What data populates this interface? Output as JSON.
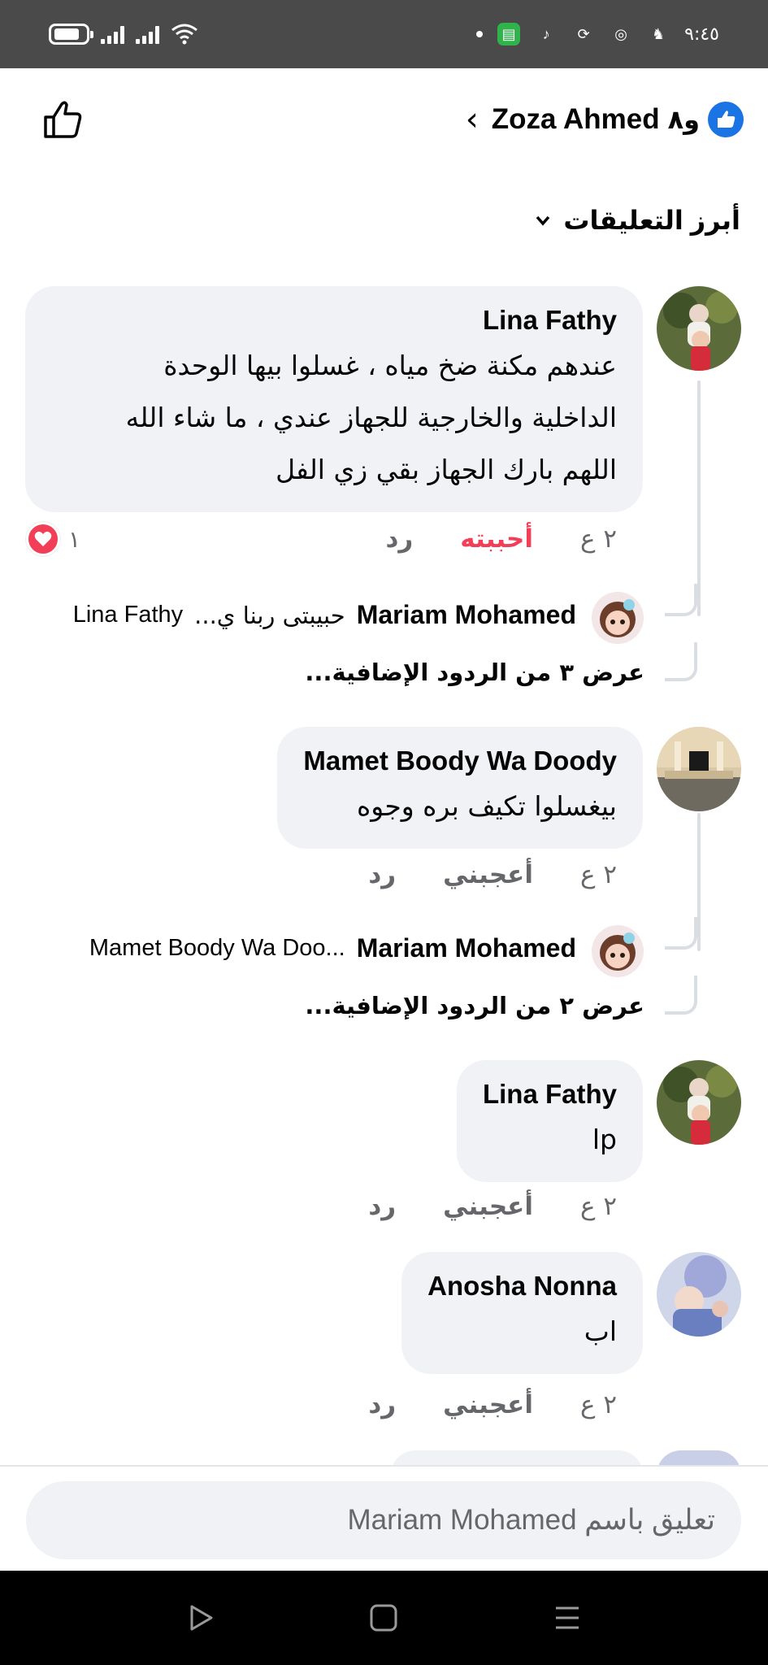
{
  "status_bar": {
    "time": "٩:٤٥",
    "icons": [
      "battery-icon",
      "signal-icon",
      "signal-icon",
      "wifi-icon",
      "dot-icon",
      "messages-app-icon",
      "tiktok-icon",
      "sync-icon",
      "messenger-icon",
      "snapchat-icon"
    ]
  },
  "header": {
    "author": "Zoza Ahmed",
    "others": "و٨",
    "back_icon": "chevron-left-icon",
    "like_icon": "thumbs-up-outline-icon",
    "reaction_badge": "like-reaction-icon",
    "badge_color": "#1b74e4"
  },
  "sort": {
    "label": "أبرز التعليقات",
    "icon": "chevron-down-icon"
  },
  "comments": [
    {
      "name": "Lina Fathy",
      "lines": [
        "عندهم مكنة ضخ مياه ، غسلوا بيها الوحدة",
        "الداخلية والخارجية للجهاز عندي ، ما شاء الله",
        "اللهم بارك الجهاز بقي زي الفل"
      ],
      "time": "٢ ع",
      "like_label": "أحببته",
      "like_color": "#f33e58",
      "reply_label": "رد",
      "reaction_count": "١",
      "reaction_icon": "heart-reaction-icon",
      "reply_preview": {
        "name": "Mariam Mohamed",
        "text": "حبيبتى ربنا ي...",
        "mention": "Lina Fathy"
      },
      "more_replies": "عرض ٣ من الردود الإضافية..."
    },
    {
      "name": "Mamet Boody Wa Doody",
      "lines": [
        "بيغسلوا تكيف بره وجوه"
      ],
      "time": "٢ ع",
      "like_label": "أعجبني",
      "reply_label": "رد",
      "reply_preview": {
        "name": "Mariam Mohamed",
        "text": "",
        "mention": "Mamet Boody Wa Doo..."
      },
      "more_replies": "عرض ٢ من الردود الإضافية..."
    },
    {
      "name": "Lina Fathy",
      "lines": [
        "lp"
      ],
      "time": "٢ ع",
      "like_label": "أعجبني",
      "reply_label": "رد"
    },
    {
      "name": "Anosha Nonna",
      "lines": [
        "اب"
      ],
      "time": "٢ ع",
      "like_label": "أعجبني",
      "reply_label": "رد"
    }
  ],
  "composer": {
    "placeholder": "تعليق باسم Mariam Mohamed"
  },
  "nav_bar": {
    "icons": [
      "back-triangle-icon",
      "home-square-icon",
      "recents-menu-icon"
    ]
  }
}
